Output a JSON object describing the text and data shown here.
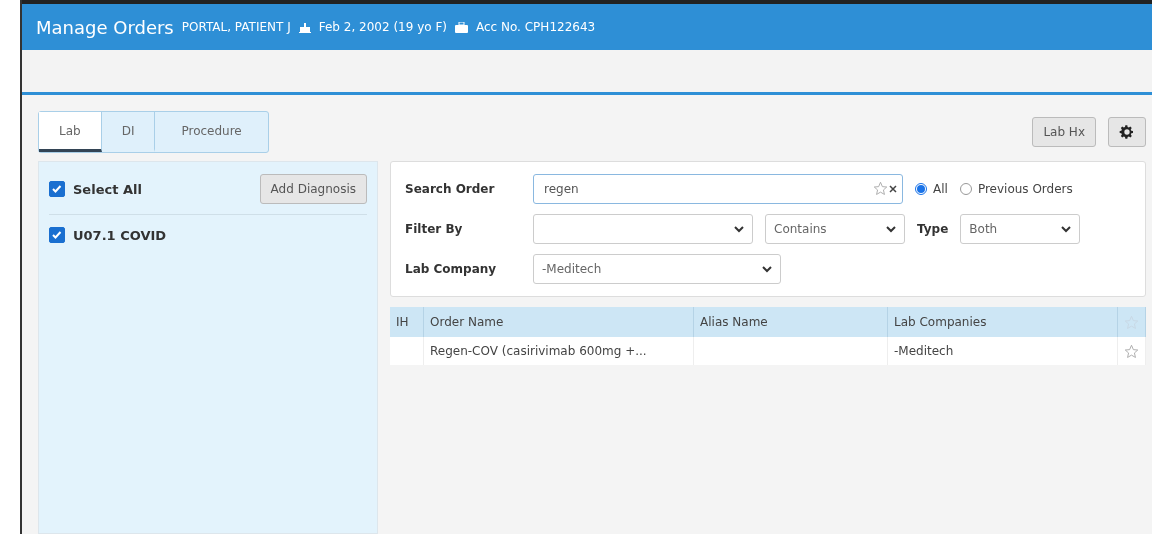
{
  "header": {
    "title": "Manage Orders",
    "patient": "PORTAL, PATIENT J",
    "dob": "Feb 2, 2002 (19 yo F)",
    "account": "Acc No. CPH122643"
  },
  "tabs": [
    {
      "label": "Lab",
      "selected": true
    },
    {
      "label": "DI",
      "selected": false
    },
    {
      "label": "Procedure",
      "selected": false
    }
  ],
  "toolbar": {
    "history_button": "Lab Hx"
  },
  "diagnoses": {
    "select_all": {
      "label": "Select All",
      "checked": true
    },
    "add_button": "Add Diagnosis",
    "items": [
      {
        "label": "U07.1 COVID",
        "checked": true
      }
    ]
  },
  "search": {
    "label": "Search Order",
    "value": "regen",
    "scope": [
      {
        "label": "All",
        "selected": true
      },
      {
        "label": "Previous Orders",
        "selected": false
      }
    ],
    "filter_label": "Filter By",
    "match": "Contains",
    "type_label": "Type",
    "type_value": "Both",
    "company_label": "Lab Company",
    "company_value": "-Meditech"
  },
  "table": {
    "columns": [
      "IH",
      "Order Name",
      "Alias Name",
      "Lab Companies"
    ],
    "rows": [
      {
        "order_name": "Regen-COV (casirivimab 600mg +...",
        "lab_company": "-Meditech",
        "favorite": false
      }
    ]
  }
}
